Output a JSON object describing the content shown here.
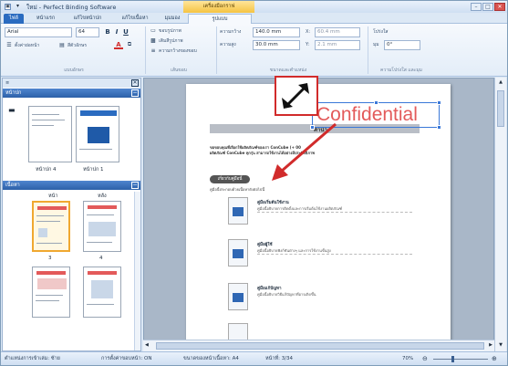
{
  "window": {
    "title": "ใหม่ - Perfect Binding Software",
    "context_tab_group": "เครื่องมือกราฟ",
    "controls": {
      "minimize": "–",
      "maximize": "□",
      "close": "✕"
    }
  },
  "tabs": [
    {
      "label": "ไฟล์"
    },
    {
      "label": "หน้าแรก"
    },
    {
      "label": "แก้ไขหน้าปก"
    },
    {
      "label": "แก้ไขเนื้อหา"
    },
    {
      "label": "มุมมอง"
    },
    {
      "label": "รูปแบบ"
    }
  ],
  "ribbon": {
    "font": {
      "font_name": "Arial",
      "font_size": "64",
      "bold": "B",
      "italic": "I",
      "underline": "U",
      "paragraph_settings": "ตั้งค่าย่อหน้า",
      "font_color_label": "สีตัวอักษร",
      "text_color_label": "A",
      "group_label": "แบบอักษร"
    },
    "shapes": {
      "outline_label": "ขอบรูปภาพ",
      "fill_label": "เติมสีรูปภาพ",
      "arrange_label": "ความกว้างของขอบ",
      "group_label": "เส้นขอบ"
    },
    "size": {
      "width_label": "ความกว้าง",
      "width_value": "140.0 mm",
      "height_label": "ความสูง",
      "height_value": "30.0 mm",
      "x_label": "X:",
      "x_value": "60.4 mm",
      "y_label": "Y:",
      "y_value": "2.1 mm",
      "group_label": "ขนาดและตำแหน่ง"
    },
    "transparency": {
      "label": "โปร่งใส",
      "angle_label": "มุม",
      "angle_value": "0°",
      "group_label": "ความโปร่งใส และมุม"
    }
  },
  "left_panel": {
    "cover_header": "หน้าปก",
    "cover_pages": [
      {
        "label": "หน้าปก 4"
      },
      {
        "label": "หน้าปก 1"
      }
    ],
    "body_header": "เนื้อหา",
    "body_columns": [
      "หน้า",
      "หลัง"
    ],
    "body_pages": [
      {
        "label": "3"
      },
      {
        "label": "4"
      }
    ]
  },
  "document": {
    "watermark_text": "Confidential",
    "doc_title": "คำนำ",
    "intro_line1": "ขอขอบคุณที่เลือกใช้ผลิตภัณฑ์ของเรา ConCube (+ 00",
    "intro_line2": "ผลิตภัณฑ์ ConCube ทุกรุ่น สามารถใช้งานได้อย่างมีประสิทธิภาพ",
    "section_heading": "เกี่ยวกับคู่มือนี้",
    "section_sub": "คู่มือนี้ประกอบด้วยเนื้อหาดังต่อไปนี้",
    "items": [
      {
        "title": "คู่มือเริ่มต้นใช้งาน",
        "desc": "คู่มือนี้อธิบายการติดตั้งและการเริ่มต้นใช้งานผลิตภัณฑ์"
      },
      {
        "title": "คู่มือผู้ใช้",
        "desc": "คู่มือนี้อธิบายฟังก์ชันต่างๆ และการใช้งานขั้นสูง"
      },
      {
        "title": "คู่มือแก้ปัญหา",
        "desc": "คู่มือนี้อธิบายวิธีแก้ปัญหาที่อาจเกิดขึ้น"
      }
    ]
  },
  "status_bar": {
    "binding": "ตำแหน่งการเข้าเล่ม: ซ้าย",
    "trim": "การตั้งค่าขอบหน้า: ON",
    "size": "ขนาดของหน้าเนื้อหา: A4",
    "page": "หน้าที่: 3/34",
    "zoom": "70%"
  },
  "colors": {
    "accent": "#2a6bc0",
    "selection": "#f0a830",
    "callout_border": "#d12b2b",
    "watermark": "#e35a5a"
  }
}
